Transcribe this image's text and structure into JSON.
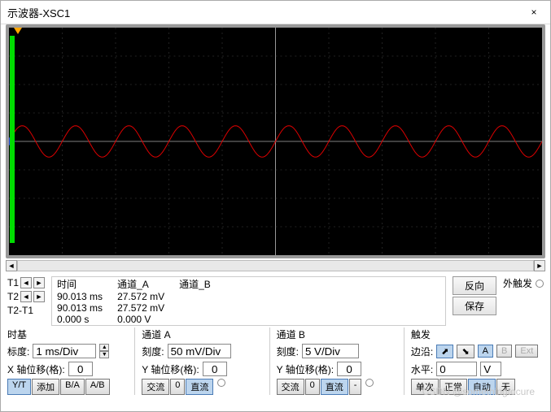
{
  "window": {
    "title": "示波器-XSC1",
    "close": "×"
  },
  "readout": {
    "headers": {
      "time": "时间",
      "chA": "通道_A",
      "chB": "通道_B"
    },
    "rows": [
      {
        "label": "T1",
        "time": "90.013 ms",
        "a": "27.572 mV",
        "b": ""
      },
      {
        "label": "T2",
        "time": "90.013 ms",
        "a": "27.572 mV",
        "b": ""
      },
      {
        "label": "T2-T1",
        "time": "0.000 s",
        "a": "0.000 V",
        "b": ""
      }
    ]
  },
  "side": {
    "reverse": "反向",
    "save": "保存",
    "ext_trigger": "外触发"
  },
  "timebase": {
    "title": "时基",
    "scale_label": "标度:",
    "scale_value": "1 ms/Div",
    "xpos_label": "X 轴位移(格):",
    "xpos_value": "0",
    "modes": {
      "yt": "Y/T",
      "add": "添加",
      "ba": "B/A",
      "ab": "A/B"
    }
  },
  "chA": {
    "title": "通道 A",
    "scale_label": "刻度:",
    "scale_value": "50 mV/Div",
    "ypos_label": "Y 轴位移(格):",
    "ypos_value": "0",
    "coupling": {
      "ac": "交流",
      "zero": "0",
      "dc": "直流"
    }
  },
  "chB": {
    "title": "通道 B",
    "scale_label": "刻度:",
    "scale_value": "5 V/Div",
    "ypos_label": "Y 轴位移(格):",
    "ypos_value": "0",
    "coupling": {
      "ac": "交流",
      "zero": "0",
      "dc": "直流",
      "minus": "-"
    }
  },
  "trigger": {
    "title": "触发",
    "edge_label": "边沿:",
    "level_label": "水平:",
    "level_value": "0",
    "level_unit": "V",
    "modes": {
      "single": "单次",
      "normal": "正常",
      "auto": "自动",
      "none": "无"
    },
    "src": {
      "a": "A",
      "b": "B",
      "ext": "Ext"
    }
  },
  "chart_data": {
    "type": "line",
    "title": "",
    "xlabel": "",
    "ylabel": "",
    "x_units": "ms",
    "y_units": "mV",
    "x_scale_per_div": 1,
    "series": [
      {
        "name": "Channel A",
        "color": "#dd0000",
        "amplitude_mV": 27.6,
        "period_ms": 1.0,
        "waveform": "sine",
        "y_scale_per_div": 50
      },
      {
        "name": "Channel B",
        "color": "#0066ff",
        "amplitude_V": 0,
        "y_scale_per_div": 5
      }
    ],
    "cursors": {
      "T1_ms": 90.013,
      "T2_ms": 90.013
    },
    "grid_divisions": {
      "x": 10,
      "y": 8
    }
  },
  "arrows": {
    "left": "◄",
    "right": "►",
    "up": "▲",
    "down": "▼",
    "rise": "⬈",
    "fall": "⬊"
  },
  "watermark": "CSDN @somethingtocure"
}
